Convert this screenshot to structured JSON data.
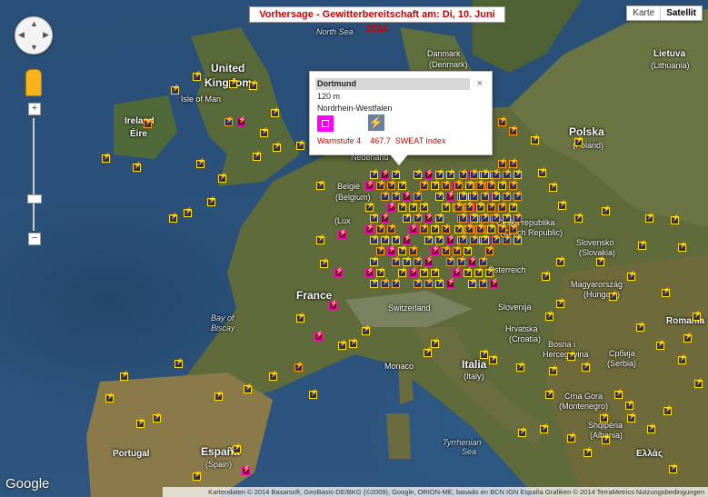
{
  "title": "Vorhersage - Gewitterbereitschaft am: Di, 10. Juni 2014",
  "map_type": {
    "map_label": "Karte",
    "satellite_label": "Satellit",
    "selected": "Satellit"
  },
  "zoom": {
    "plus": "+",
    "minus": "−"
  },
  "popup": {
    "city": "Dortmund",
    "close": "×",
    "altitude": "120 m",
    "region": "Nordrhein-Westfalen",
    "warn_level": "Warnstufe 4",
    "index_value": "467.7",
    "index_name": "SWEAT Index"
  },
  "labels": {
    "north_sea": "North Sea",
    "uk": "United",
    "uk2": "Kingdom",
    "isle_of_man": "Isle of Man",
    "ireland": "Ireland",
    "eire": "Éire",
    "france": "France",
    "bay": "Bay of",
    "biscay": "Biscay",
    "nederland": "Nederland",
    "belgie": "België",
    "belgium": "(Belgium)",
    "lux": "(Lux",
    "denmark": "(Denmark)",
    "danmark": "Danmark",
    "lietuva": "Lietuva",
    "lithuania": "(Lithuania)",
    "polska": "Polska",
    "poland": "(Poland)",
    "ceska": "Česká republika",
    "czech": "(Czech Republic)",
    "slovensko": "Slovensko",
    "slovakia": "(Slovakia)",
    "magyar": "Magyarország",
    "hungary": "(Hungary)",
    "romania": "Romania",
    "osterreich": "Österreich",
    "switzerland": "Switzerland",
    "slovenija": "Slovenija",
    "hrvatska": "Hrvatska",
    "croatia": "(Croatia)",
    "bih": "Bosna i",
    "hercegovina": "Hercegovina",
    "srbija": "Србија",
    "serbia": "(Serbia)",
    "crna_gora": "Crna Gora",
    "montenegro": "(Montenegro)",
    "shqiperia": "Shqipëria",
    "albania": "(Albania)",
    "italia": "Italia",
    "italy": "(Italy)",
    "monaco": "Monaco",
    "tyrrhenian": "Tyrrhenian",
    "sea": "Sea",
    "portugal": "Portugal",
    "espana": "España",
    "spain": "(Spain)",
    "ellas": "Ελλάς",
    "cyprus": "Greece"
  },
  "google": "Google",
  "attribution": "Kartendaten © 2014 Basarsoft, GeoBasis-DE/BKG (©2009), Google, ORION-ME, basado en BCN IGN España Grafiken © 2014 TerraMetrics  Nutzungsbedingungen",
  "colors": {
    "warning_red": "#d00000",
    "marker_yellow": "#ffe300",
    "marker_orange": "#ff9a00",
    "marker_magenta": "#ff00b0"
  }
}
